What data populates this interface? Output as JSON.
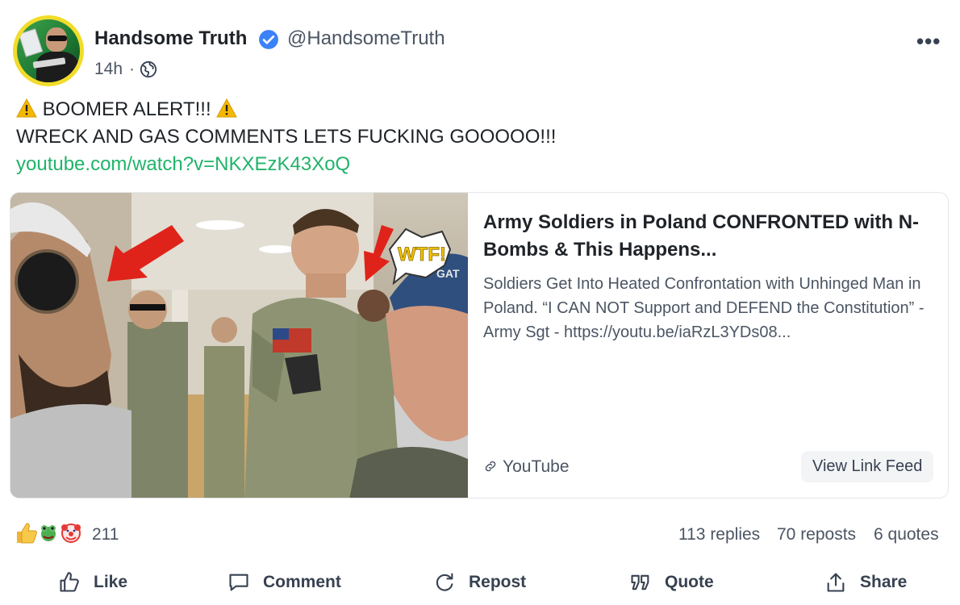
{
  "author": {
    "name": "Handsome Truth",
    "handle": "@HandsomeTruth",
    "time": "14h",
    "separator": "·",
    "verified_color": "#3b82f6"
  },
  "menu_label": "•••",
  "post": {
    "line1": "BOOMER ALERT!!!",
    "line2": "WRECK AND GAS COMMENTS LETS FUCKING GOOOOO!!!",
    "link": "youtube.com/watch?v=NKXEzK43XoQ",
    "link_color": "#21b36a"
  },
  "card": {
    "title": "Army Soldiers in Poland CONFRONTED with N-Bombs & This Happens...",
    "description": "Soldiers Get Into Heated Confrontation with Unhinged Man in Poland. “I CAN NOT Support and DEFEND the Constitution” - Army Sgt - https://youtu.be/iaRzL3YDs08...",
    "source": "YouTube",
    "view_feed": "View Link Feed",
    "thumbnail_text": "WTF!",
    "cap_text": "GAT"
  },
  "stats": {
    "reactions_count": "211",
    "replies": "113 replies",
    "reposts": "70 reposts",
    "quotes": "6 quotes"
  },
  "actions": {
    "like": "Like",
    "comment": "Comment",
    "repost": "Repost",
    "quote": "Quote",
    "share": "Share"
  }
}
